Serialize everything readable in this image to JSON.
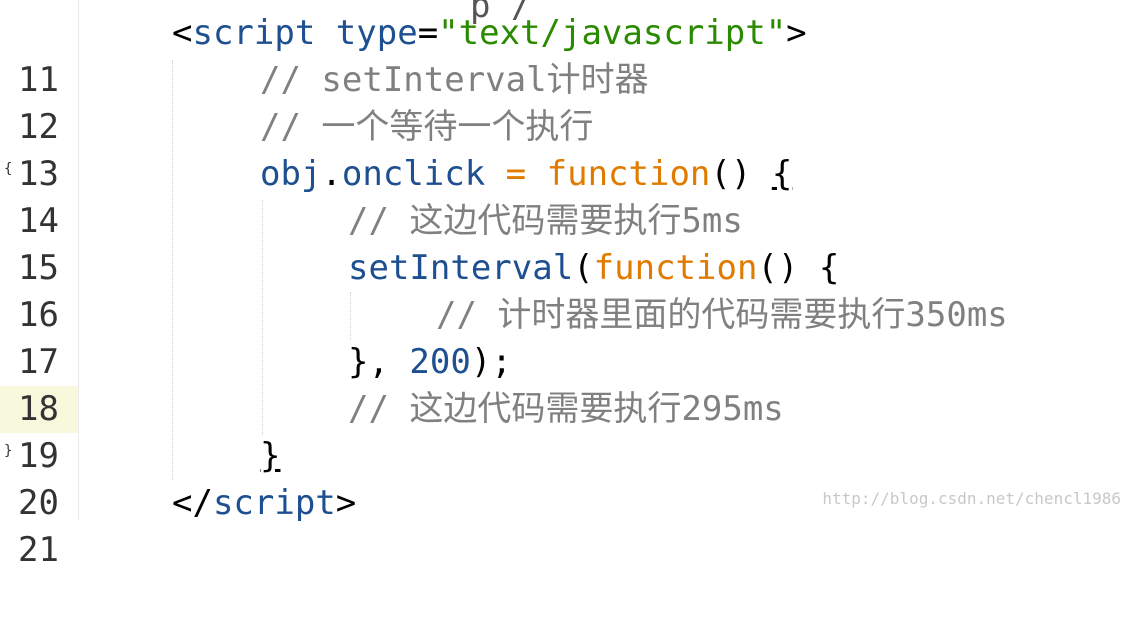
{
  "editor": {
    "lines": [
      {
        "number": "11",
        "tokens": [
          "<",
          "script",
          " ",
          "type",
          "=",
          "\"text/javascript\"",
          ">"
        ]
      },
      {
        "number": "12",
        "tokens": [
          "// setInterval计时器"
        ]
      },
      {
        "number": "13",
        "tokens": [
          "// 一个等待一个执行"
        ]
      },
      {
        "number": "14",
        "tokens": [
          "obj",
          ".",
          "onclick",
          " = ",
          "function",
          "() ",
          "{"
        ]
      },
      {
        "number": "15",
        "tokens": [
          "// 这边代码需要执行5ms"
        ]
      },
      {
        "number": "16",
        "tokens": [
          "setInterval",
          "(",
          "function",
          "() {"
        ]
      },
      {
        "number": "17",
        "tokens": [
          "// 计时器里面的代码需要执行350ms"
        ]
      },
      {
        "number": "18",
        "tokens": [
          "}, ",
          "200",
          ");"
        ]
      },
      {
        "number": "19",
        "tokens": [
          "// 这边代码需要执行295ms"
        ]
      },
      {
        "number": "20",
        "tokens": [
          "}"
        ]
      },
      {
        "number": "21",
        "tokens": [
          "</",
          "script",
          ">"
        ]
      }
    ],
    "fold_open": "{",
    "fold_close": "}",
    "active_line": "18"
  },
  "watermark": "http://blog.csdn.net/chencl1986",
  "colors": {
    "keyword": "#1d4f91",
    "string": "#2a8a00",
    "comment": "#808080",
    "function_keyword": "#e07b00",
    "active_line_bg": "#f7f8dc"
  }
}
